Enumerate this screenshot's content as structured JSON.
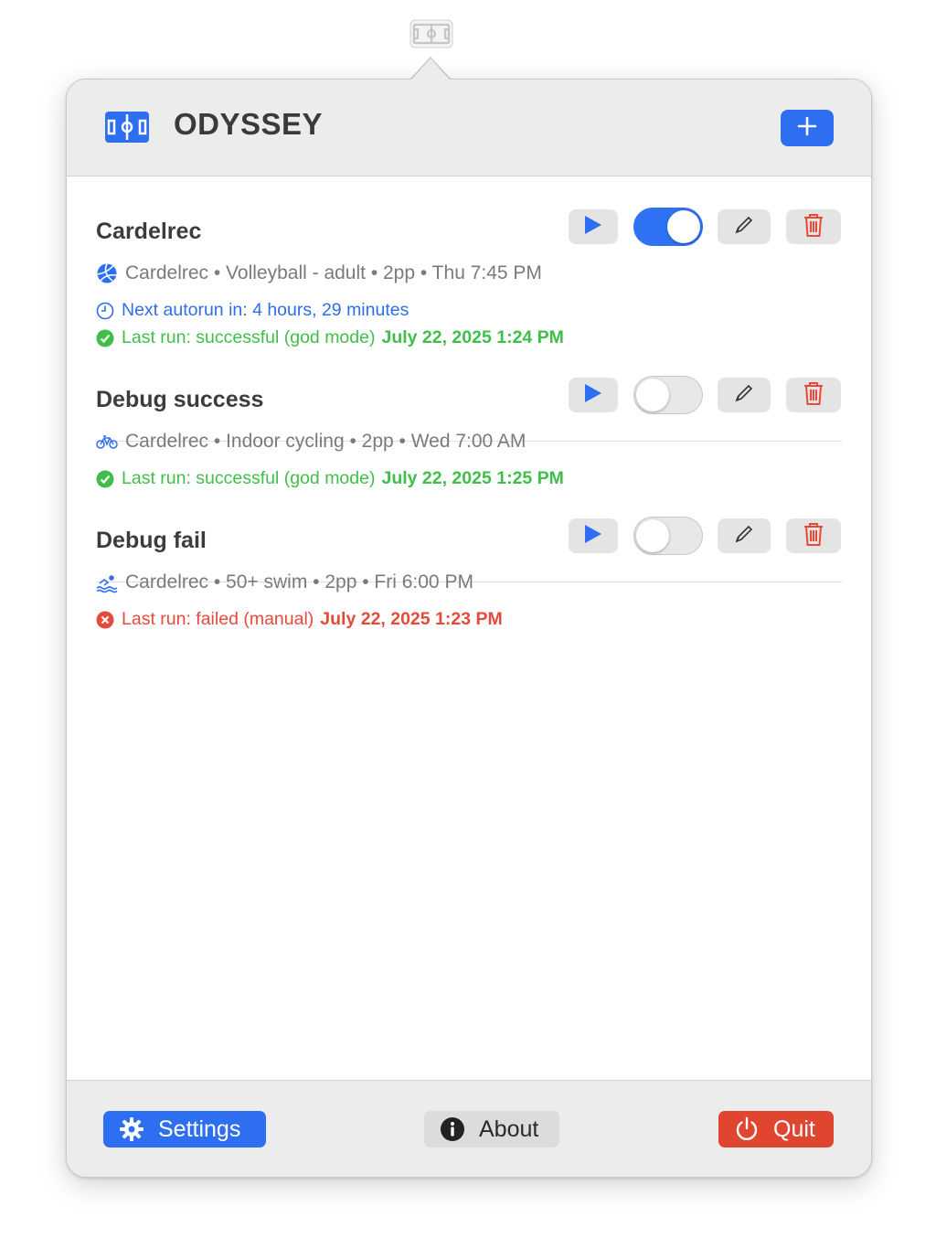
{
  "app": {
    "title": "ODYSSEY"
  },
  "colors": {
    "accent": "#2e6ff2",
    "success": "#3fbf4a",
    "danger": "#e64a3a",
    "info": "#2d6fe6"
  },
  "header": {
    "logo_icon": "field-icon",
    "add_icon": "plus-icon"
  },
  "items": [
    {
      "title": "Cardelrec",
      "enabled": true,
      "sport_icon": "volleyball-icon",
      "meta": "Cardelrec • Volleyball - adult • 2pp • Thu 7:45 PM",
      "next_autorun": "Next autorun in: 4 hours, 29 minutes",
      "last_run_status": "Last run: successful (god mode)",
      "last_run_time": "July 22, 2025 1:24 PM",
      "status": "success"
    },
    {
      "title": "Debug success",
      "enabled": false,
      "sport_icon": "bicycle-icon",
      "meta": "Cardelrec • Indoor cycling • 2pp • Wed 7:00 AM",
      "last_run_status": "Last run: successful (god mode)",
      "last_run_time": "July 22, 2025 1:25 PM",
      "status": "success"
    },
    {
      "title": "Debug fail",
      "enabled": false,
      "sport_icon": "swimming-icon",
      "meta": "Cardelrec • 50+ swim • 2pp • Fri 6:00 PM",
      "last_run_status": "Last run: failed (manual)",
      "last_run_time": "July 22, 2025 1:23 PM",
      "status": "failed"
    }
  ],
  "footer": {
    "settings_label": "Settings",
    "about_label": "About",
    "quit_label": "Quit"
  }
}
